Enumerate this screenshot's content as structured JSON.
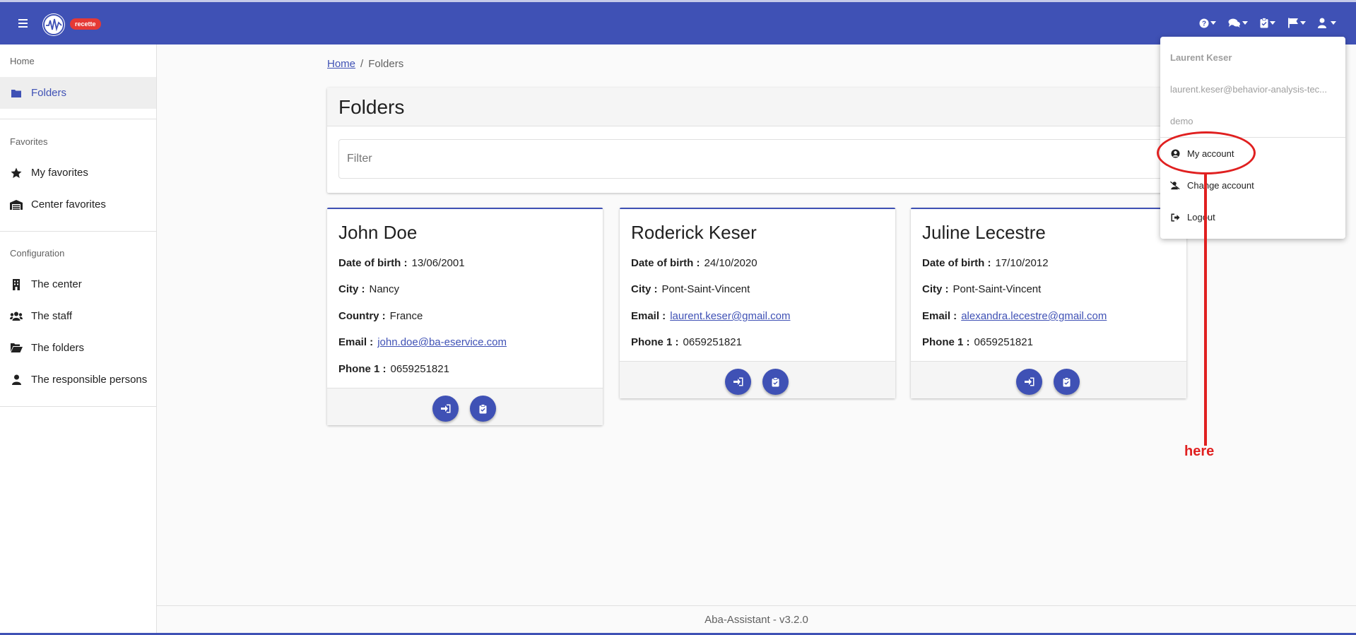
{
  "appbar": {
    "env_badge": "recette",
    "icons": [
      "help-icon",
      "chat-icon",
      "clipboard-icon",
      "flag-icon",
      "user-icon"
    ],
    "colors": {
      "primary": "#3f51b5",
      "badge": "#e53935",
      "annotation": "#e02020"
    }
  },
  "sidebar": {
    "home_section": "Home",
    "folders": "Folders",
    "favorites_section": "Favorites",
    "my_favorites": "My favorites",
    "center_favorites": "Center favorites",
    "config_section": "Configuration",
    "the_center": "The center",
    "the_staff": "The staff",
    "the_folders": "The folders",
    "responsible_persons": "The responsible persons"
  },
  "breadcrumb": {
    "home": "Home",
    "current": "Folders"
  },
  "panel": {
    "title": "Folders",
    "filter_placeholder": "Filter"
  },
  "labels": {
    "dob": "Date of birth :",
    "city": "City :",
    "country": "Country :",
    "email": "Email :",
    "phone": "Phone 1 :"
  },
  "cards": [
    {
      "name": "John Doe",
      "dob": "13/06/2001",
      "city": "Nancy",
      "country": "France",
      "email": "john.doe@ba-eservice.com",
      "phone": "0659251821"
    },
    {
      "name": "Roderick Keser",
      "dob": "24/10/2020",
      "city": "Pont-Saint-Vincent",
      "email": "laurent.keser@gmail.com",
      "phone": "0659251821"
    },
    {
      "name": "Juline Lecestre",
      "dob": "17/10/2012",
      "city": "Pont-Saint-Vincent",
      "email": "alexandra.lecestre@gmail.com",
      "phone": "0659251821"
    }
  ],
  "dropdown": {
    "user_name": "Laurent Keser",
    "user_email": "laurent.keser@behavior-analysis-tec...",
    "user_role": "demo",
    "my_account": "My account",
    "change_account": "Change account",
    "logout": "Logout"
  },
  "annotation": {
    "text": "here"
  },
  "footer": {
    "text": "Aba-Assistant - v3.2.0"
  }
}
